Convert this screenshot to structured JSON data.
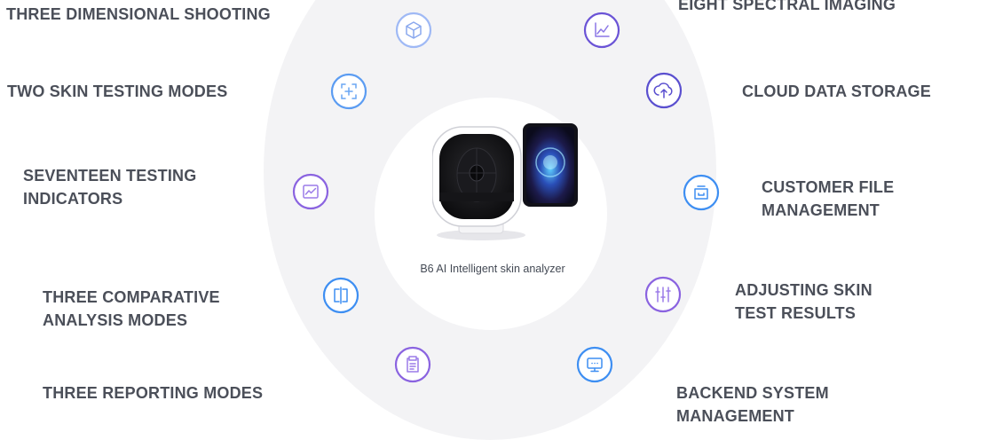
{
  "colors": {
    "ring_background": "#f3f3f5",
    "label_text": "#4b4f59",
    "accent_blue": "#3d8ef2",
    "accent_purple": "#8a63e0",
    "accent_indigo": "#5a4fcf"
  },
  "product": {
    "caption": "B6  AI Intelligent skin analyzer"
  },
  "features": [
    {
      "id": "three-dimensional-shooting",
      "label_lines": [
        "THREE DIMENSIONAL SHOOTING"
      ],
      "icon": "cube-icon"
    },
    {
      "id": "eight-spectral-imaging",
      "label_lines": [
        "EIGHT SPECTRAL IMAGING"
      ],
      "icon": "chart-axes-icon"
    },
    {
      "id": "two-skin-testing-modes",
      "label_lines": [
        "TWO SKIN TESTING MODES"
      ],
      "icon": "scan-plus-icon"
    },
    {
      "id": "cloud-data-storage",
      "label_lines": [
        "CLOUD DATA  STORAGE"
      ],
      "icon": "cloud-upload-icon"
    },
    {
      "id": "seventeen-testing-indicators",
      "label_lines": [
        "SEVENTEEN TESTING",
        "INDICATORS"
      ],
      "icon": "trend-chart-icon"
    },
    {
      "id": "customer-file-management",
      "label_lines": [
        "CUSTOMER FILE",
        "MANAGEMENT"
      ],
      "icon": "folder-box-icon"
    },
    {
      "id": "three-comparative-analysis-modes",
      "label_lines": [
        "THREE COMPARATIVE",
        "ANALYSIS MODES"
      ],
      "icon": "split-compare-icon"
    },
    {
      "id": "adjusting-skin-test-results",
      "label_lines": [
        "ADJUSTING SKIN",
        "TEST RESULTS"
      ],
      "icon": "sliders-icon"
    },
    {
      "id": "three-reporting-modes",
      "label_lines": [
        "THREE REPORTING MODES"
      ],
      "icon": "clipboard-icon"
    },
    {
      "id": "backend-system-management",
      "label_lines": [
        "BACKEND SYSTEM",
        "MANAGEMENT"
      ],
      "icon": "monitor-icon"
    }
  ]
}
